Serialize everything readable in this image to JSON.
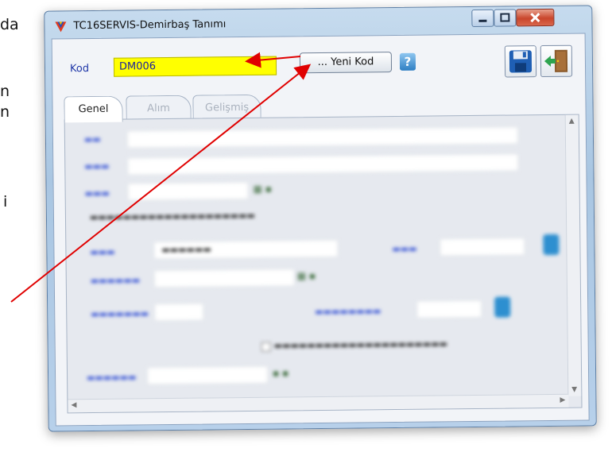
{
  "left_document_fragments": [
    "da",
    "n",
    "n",
    "i"
  ],
  "window": {
    "title": "TC16SERVIS-Demirbaş Tanımı",
    "controls": [
      "minimize",
      "maximize",
      "close"
    ]
  },
  "header": {
    "kod_label": "Kod",
    "kod_value": "DM006",
    "yeni_kod_label": "... Yeni Kod",
    "help_icon": "question-icon",
    "save_icon": "floppy-disk-icon",
    "exit_icon": "exit-door-icon"
  },
  "tabs": [
    {
      "label": "Genel",
      "active": true
    },
    {
      "label": "Alım",
      "active": false
    },
    {
      "label": "Gelişmiş",
      "active": false
    }
  ],
  "form": {
    "obscured": true
  },
  "colors": {
    "kod_highlight": "#ffff00",
    "label_blue": "#1f37a8",
    "annotation_red": "#e00000"
  }
}
